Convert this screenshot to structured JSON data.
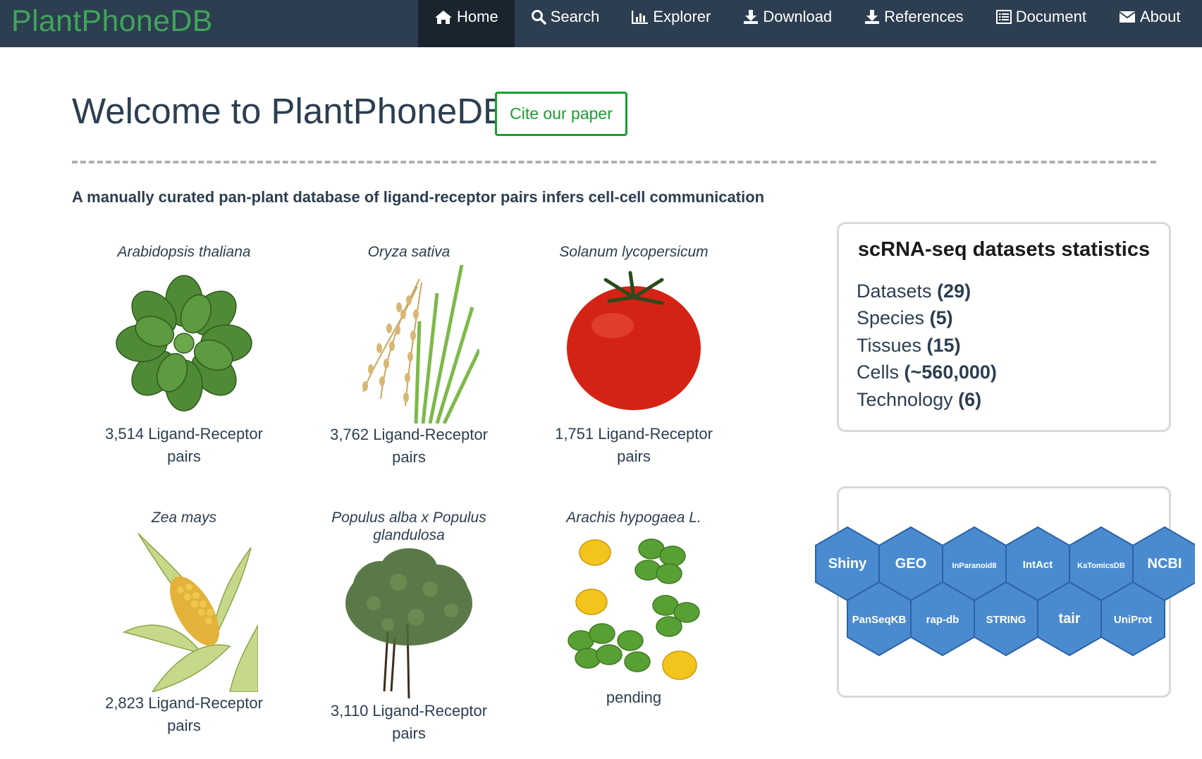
{
  "brand": "PlantPhoneDB",
  "nav": [
    {
      "label": "Home",
      "icon": "home-icon",
      "active": true
    },
    {
      "label": "Search",
      "icon": "search-icon"
    },
    {
      "label": "Explorer",
      "icon": "bar-chart-icon"
    },
    {
      "label": "Download",
      "icon": "download-icon"
    },
    {
      "label": "References",
      "icon": "download-icon"
    },
    {
      "label": "Document",
      "icon": "list-alt-icon"
    },
    {
      "label": "About",
      "icon": "envelope-icon"
    }
  ],
  "header": {
    "title": "Welcome to PlantPhoneDB!",
    "cite_label": "Cite our paper",
    "tagline": "A manually curated pan-plant database of ligand-receptor pairs infers cell-cell communication"
  },
  "species": [
    {
      "name": "Arabidopsis thaliana",
      "count_line1": "3,514 Ligand-Receptor",
      "count_line2": "pairs"
    },
    {
      "name": "Oryza sativa",
      "count_line1": "3,762 Ligand-Receptor",
      "count_line2": "pairs"
    },
    {
      "name": "Solanum lycopersicum",
      "count_line1": "1,751 Ligand-Receptor",
      "count_line2": "pairs"
    },
    {
      "name": "Zea mays",
      "count_line1": "2,823 Ligand-Receptor",
      "count_line2": "pairs"
    },
    {
      "name": "Populus alba x Populus",
      "name_line2": "glandulosa",
      "count_line1": "3,110 Ligand-Receptor",
      "count_line2": "pairs"
    },
    {
      "name": "Arachis hypogaea L.",
      "count_line1": "pending",
      "count_line2": ""
    }
  ],
  "stats": {
    "title": "scRNA-seq datasets statistics",
    "rows": [
      {
        "label": "Datasets",
        "value": "(29)"
      },
      {
        "label": "Species",
        "value": "(5)"
      },
      {
        "label": "Tissues",
        "value": "(15)"
      },
      {
        "label": "Cells",
        "value": "(~560,000)"
      },
      {
        "label": "Technology",
        "value": "(6)"
      }
    ]
  },
  "resources": [
    "Shiny",
    "GEO",
    "InParanoid8",
    "IntAct",
    "KaTomicsDB",
    "NCBI",
    "PanSeqKB",
    "rap-db",
    "STRING",
    "tair",
    "UniProt"
  ],
  "colors": {
    "navbar": "#2c3e50",
    "brand": "#3fa55a",
    "cite": "#18a030",
    "hex": "#4a8bd0"
  }
}
